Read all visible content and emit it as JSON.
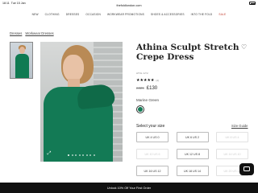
{
  "status_bar": {
    "time": "18:11",
    "date": "Tue 15 Jan"
  },
  "browser": {
    "url": "thefoldlondon.com"
  },
  "nav": {
    "items": [
      "NEW",
      "CLOTHING",
      "DRESSES",
      "OCCASION",
      "WORKWEAR PROMOTIONS",
      "SHOES & ACCESSORIES",
      "INTO THE FOLD"
    ],
    "sale_label": "SALE",
    "sale_color": "#c0392b"
  },
  "breadcrumb": [
    "Dresses",
    "Workwear Dresses"
  ],
  "gallery": {
    "slide_count": 8,
    "active_slide": 1
  },
  "product": {
    "title": "Athina Sculpt Stretch Crepe Dress",
    "sku": "AT9L GT2",
    "rating_stars": "★★★★★",
    "rating_count": "(4)",
    "price_old": "£325",
    "price_new": "£130",
    "colour_name": "Marine Green",
    "colour_hex": "#137a55"
  },
  "sizes": {
    "label": "Select your size",
    "guide_label": "Size Guide",
    "options": [
      {
        "label": "UK 4 US 0",
        "available": true
      },
      {
        "label": "UK 6 US 2",
        "available": true
      },
      {
        "label": "UK 8 US 4",
        "available": false
      },
      {
        "label": "UK 10 US 6",
        "available": false
      },
      {
        "label": "UK 12 US 8",
        "available": true
      },
      {
        "label": "UK 14 US 10",
        "available": false
      },
      {
        "label": "UK 16 US 12",
        "available": true
      },
      {
        "label": "UK 18 US 14",
        "available": true
      },
      {
        "label": "UK 20 US 16",
        "available": false
      }
    ]
  },
  "promo": {
    "text": "Unlock 10% Off Your First Order"
  }
}
